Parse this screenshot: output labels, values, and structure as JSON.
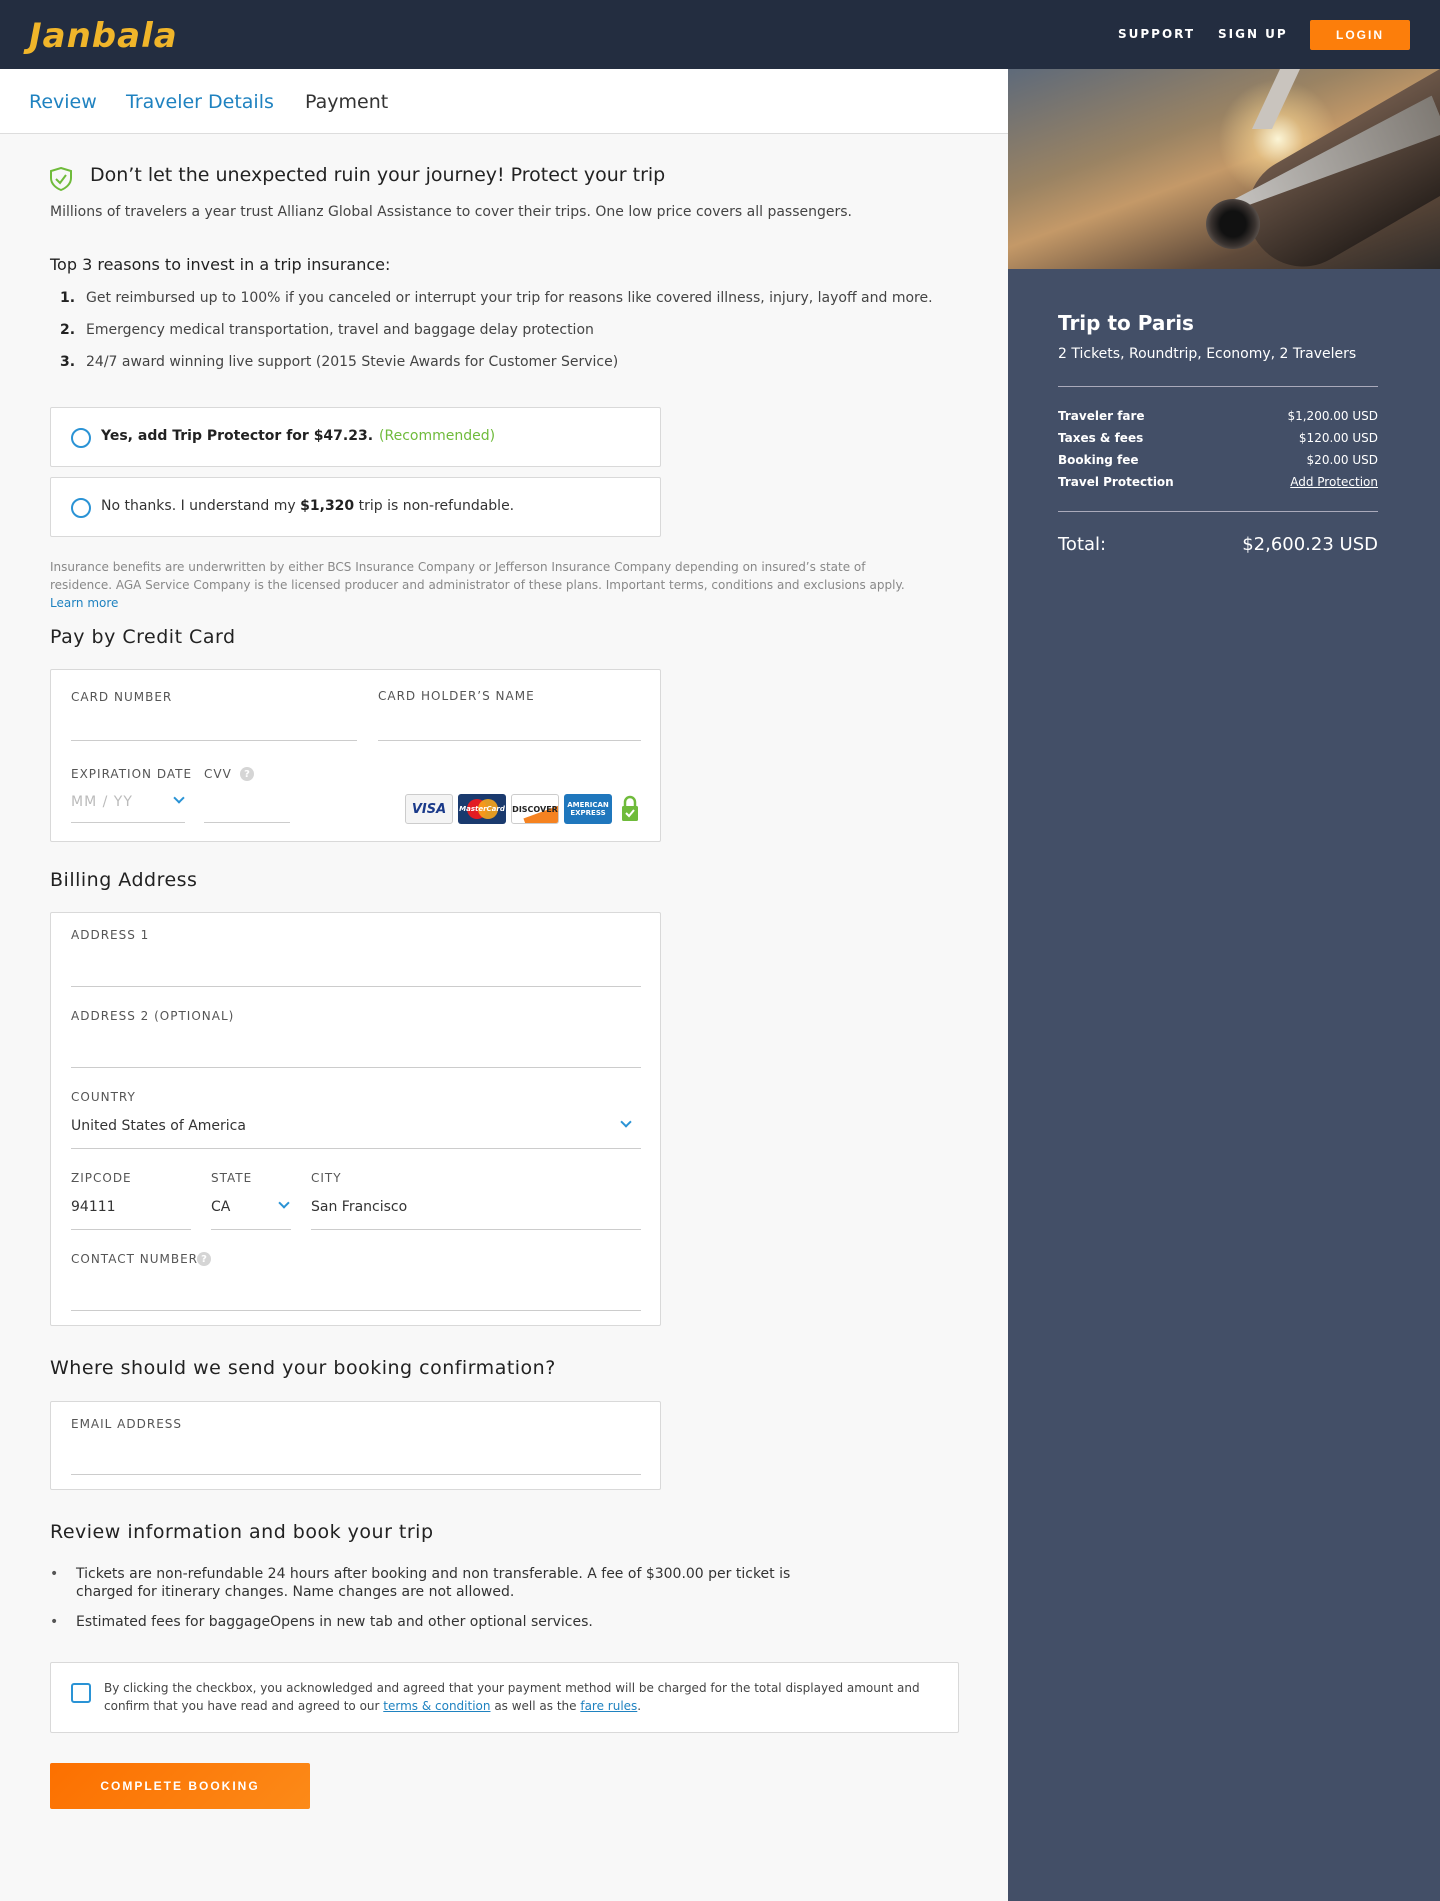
{
  "header": {
    "logo": "Janbala",
    "nav": [
      "SUPPORT",
      "SIGN UP"
    ],
    "login": "LOGIN",
    "accent": "#fc7e0b"
  },
  "tabs": [
    {
      "label": "Review",
      "state": "done"
    },
    {
      "label": "Traveler Details",
      "state": "done"
    },
    {
      "label": "Payment",
      "state": "active"
    }
  ],
  "insurance": {
    "title": "Don’t let the unexpected ruin your journey! Protect your trip",
    "subtitle": "Millions of travelers a year trust Allianz Global Assistance to cover their trips. One low price covers all passengers.",
    "reasons_title": "Top 3 reasons to invest in a trip insurance:",
    "reasons": [
      {
        "num": "1.",
        "text": "Get reimbursed up to 100% if you canceled or interrupt your trip for reasons like covered illness, injury, layoff and more."
      },
      {
        "num": "2.",
        "text": "Emergency medical transportation, travel and baggage delay protection"
      },
      {
        "num": "3.",
        "text": "24/7 award winning live support (2015 Stevie Awards for Customer Service)"
      }
    ],
    "option_yes": "Yes, add Trip Protector for $47.23.",
    "option_yes_tag": "(Recommended)",
    "option_no_pre": "No thanks. I understand my ",
    "option_no_amount": "$1,320",
    "option_no_post": " trip is non-refundable.",
    "disclaimer": "Insurance benefits are underwritten by either BCS Insurance Company or Jefferson Insurance Company depending on insured’s state of residence. AGA Service Company is the licensed producer and administrator of these plans. Important terms, conditions and exclusions apply.",
    "learn_more": "Learn more"
  },
  "payment": {
    "title": "Pay by Credit Card",
    "card_number_label": "CARD NUMBER",
    "card_holder_label": "CARD HOLDER’S NAME",
    "expiration_label": "EXPIRATION DATE",
    "expiration_placeholder": "MM  /  YY",
    "cvv_label": "CVV",
    "help": "?",
    "cards": {
      "visa": "VISA",
      "mastercard": "MasterCard",
      "discover": "DISCOVER",
      "amex_line1": "AMERICAN",
      "amex_line2": "EXPRESS"
    }
  },
  "billing": {
    "title": "Billing Address",
    "address1_label": "ADDRESS 1",
    "address2_label": "ADDRESS 2  (OPTIONAL)",
    "country_label": "COUNTRY",
    "country_value": "United States of America",
    "zip_label": "ZIPCODE",
    "zip_value": "94111",
    "state_label": "STATE",
    "state_value": "CA",
    "city_label": "CITY",
    "city_value": "San Francisco",
    "contact_label": "CONTACT NUMBER",
    "help": "?"
  },
  "confirmation": {
    "title": "Where should we send your booking confirmation?",
    "email_label": "EMAIL ADDRESS"
  },
  "review": {
    "title": "Review information and book your trip",
    "bullets": [
      "Tickets are non-refundable 24 hours after booking and non transferable. A fee of $300.00 per ticket is charged for itinerary changes. Name changes are not allowed.",
      "Estimated fees for baggageOpens in new tab and other optional services."
    ],
    "agree_pre": "By clicking the checkbox, you acknowledged and agreed that your payment method will be charged for the total displayed amount and confirm that you have read and agreed to our ",
    "agree_terms": "terms & condition",
    "agree_mid": " as well as the ",
    "agree_fare": "fare rules",
    "agree_post": ".",
    "complete_button": "COMPLETE BOOKING"
  },
  "summary": {
    "title": "Trip to Paris",
    "subtitle": "2 Tickets, Roundtrip, Economy, 2 Travelers",
    "rows": [
      {
        "label": "Traveler fare",
        "value": "$1,200.00 USD"
      },
      {
        "label": "Taxes & fees",
        "value": "$120.00 USD"
      },
      {
        "label": "Booking fee",
        "value": "$20.00 USD"
      },
      {
        "label": "Travel Protection",
        "value": "Add Protection"
      }
    ],
    "total_label": "Total:",
    "total_value": "$2,600.23 USD"
  }
}
